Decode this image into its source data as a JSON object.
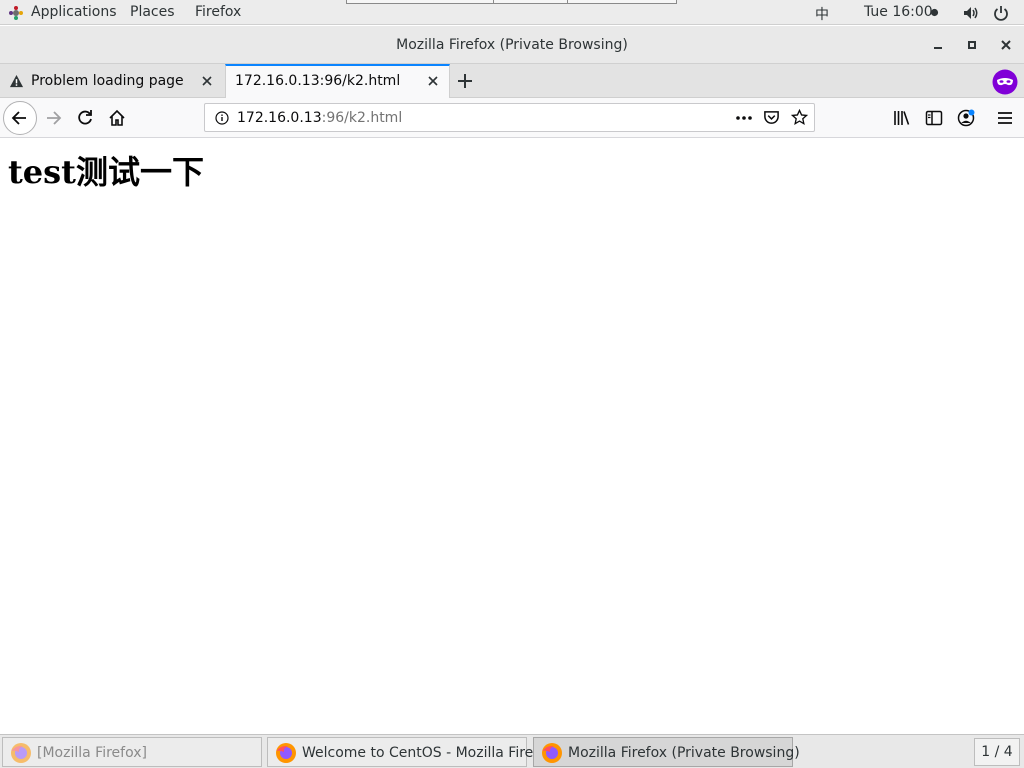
{
  "topbar": {
    "applications": "Applications",
    "places": "Places",
    "firefox": "Firefox",
    "input_method": "中",
    "clock": "Tue 16:00",
    "icons": [
      "apps-icon",
      "volume-icon",
      "power-icon"
    ]
  },
  "window": {
    "title": "Mozilla Firefox (Private Browsing)"
  },
  "tabs": [
    {
      "label": "Problem loading page",
      "icon": "warning-icon",
      "active": false
    },
    {
      "label": "172.16.0.13:96/k2.html",
      "active": true
    }
  ],
  "urlbar": {
    "host": "172.16.0.13",
    "path": ":96/k2.html"
  },
  "page": {
    "heading": "test测试一下"
  },
  "taskbar": {
    "items": [
      {
        "label": "[Mozilla Firefox]",
        "minimized": true
      },
      {
        "label": "Welcome to CentOS - Mozilla Firefox",
        "minimized": false
      },
      {
        "label": "Mozilla Firefox (Private Browsing)",
        "active": true
      }
    ],
    "workspace": "1 / 4"
  },
  "colors": {
    "tab_accent": "#0a84ff",
    "private_purple": "#8000d7"
  }
}
